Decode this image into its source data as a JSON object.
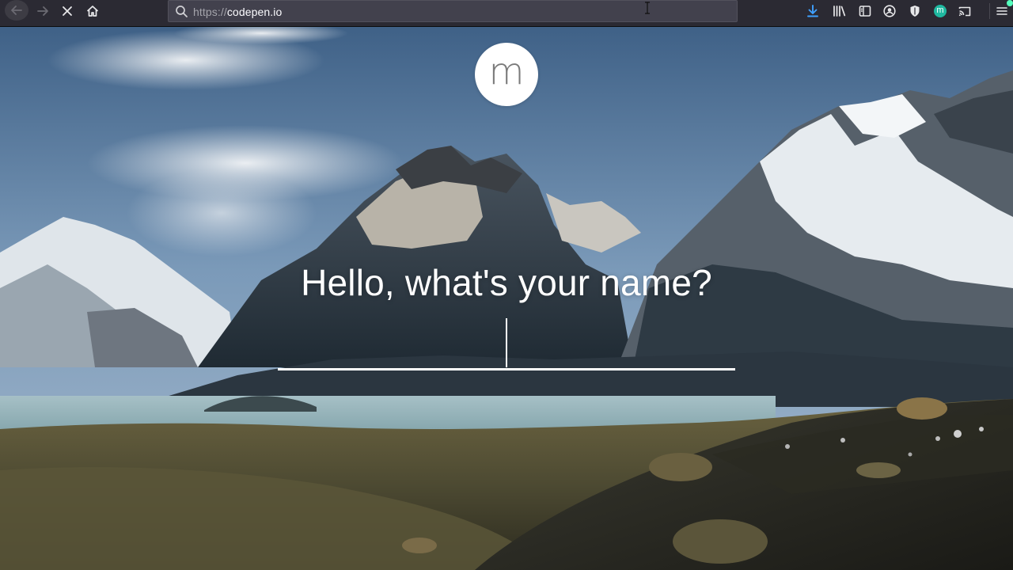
{
  "browser": {
    "url_scheme": "https://",
    "url_host": "codepen.io",
    "profile_initial": "m"
  },
  "icons": {
    "back": "arrow-left-icon",
    "forward": "arrow-right-icon",
    "stop": "close-icon",
    "home": "home-icon",
    "search": "search-icon",
    "downloads": "download-icon",
    "library": "library-icon",
    "sidebar": "sidebar-icon",
    "account": "account-icon",
    "shield": "shield-icon",
    "cast": "cast-icon",
    "menu": "hamburger-icon"
  },
  "colors": {
    "toolbar": "#2b2a33",
    "urlbar": "#42414d",
    "accent_download": "#3fa1ff",
    "profile": "#1fb8a0"
  },
  "app": {
    "logo_letter": "m",
    "prompt": "Hello, what's your name?",
    "name_value": "",
    "name_placeholder": ""
  }
}
